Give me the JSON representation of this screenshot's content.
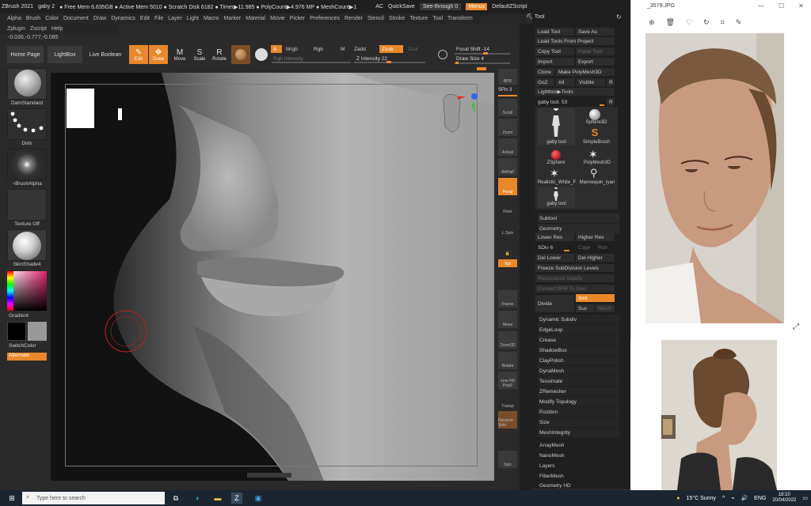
{
  "zbrush": {
    "title_items": [
      "ZBrush 2021",
      "gaby 2",
      "● Free Mem 6.635GB ● Active Mem 5010 ● Scratch Disk 6182 ● Timer▶11.985 ● PolyCount▶4.976 MP ● MeshCount▶1",
      "AC",
      "QuickSave"
    ],
    "see_through": "See-through   0",
    "menus_btn": "Menus",
    "zscript_label": "DefaultZScript",
    "menu_items": [
      "Alpha",
      "Brush",
      "Color",
      "Document",
      "Draw",
      "Dynamics",
      "Edit",
      "File",
      "Layer",
      "Light",
      "Macro",
      "Marker",
      "Material",
      "Movie",
      "Picker",
      "Preferences",
      "Render",
      "Stencil",
      "Stroke",
      "Texture",
      "Tool",
      "Transform"
    ],
    "menu_items2": [
      "Zplugin",
      "Zscript",
      "Help"
    ],
    "coords": "-0.036,-0.777,-0.085",
    "shelf": {
      "home_page": "Home Page",
      "lightbox": "LightBox",
      "live_boolean": "Live Boolean",
      "edit": "Edit",
      "draw": "Draw",
      "move": "Move",
      "scale": "Scale",
      "rotate": "Rotate",
      "a": "A",
      "mrgb": "Mrgb",
      "rgb": "Rgb",
      "m": "M",
      "zadd": "Zadd",
      "zsub": "Zsub",
      "zcut": "Zcut",
      "rgb_intensity": "Rgb Intensity",
      "z_intensity": "Z Intensity 22",
      "focal_shift": "Focal Shift -14",
      "draw_size": "Draw Size 4"
    },
    "left_panel": {
      "brush": "DamStandard",
      "stroke": "Dots",
      "alpha": "~BrushAlpha",
      "texture": "Texture Off",
      "material": "SkinShade4",
      "gradient": "Gradient",
      "switch_color": "SwitchColor",
      "alternate": "Alternate"
    },
    "right_toolbar": [
      "BPR",
      "SPix 3",
      "Scroll",
      "Zoom",
      "Actual",
      "AAHalf",
      "Persp",
      "Floor",
      "L.Sym",
      "Xyz",
      "Frame",
      "Move",
      "Zoom3D",
      "Rotate",
      "Line Fill PolyF",
      "Transp",
      "Dynamic Solo",
      "Spix"
    ],
    "tool_panel": {
      "header": "Tool",
      "load_tool": "Load Tool",
      "save_as": "Save As",
      "load_tools_from_project": "Load Tools From Project",
      "copy_tool": "Copy Tool",
      "paste_tool": "Paste Tool",
      "import": "Import",
      "export": "Export",
      "clone": "Clone",
      "make_polymesh": "Make PolyMesh3D",
      "goz": "GoZ",
      "all": "All",
      "visible": "Visible",
      "r": "R",
      "lightbox_tools": "Lightbox▶Tools",
      "gaby_tool_slider": "gaby tool. 53",
      "tools": [
        "gaby tool",
        "Sphere3D",
        "SimpleBrush",
        "ZSphere",
        "PolyMesh3D",
        "Realistic_White_F",
        "Mannequin_ryan",
        "gaby tool"
      ],
      "subtool": "Subtool",
      "geometry": "Geometry",
      "lower_res": "Lower Res",
      "higher_res": "Higher Res",
      "sdiv": "SDiv 6",
      "cage": "Cage",
      "rstr": "Rstr",
      "del_lower": "Del Lower",
      "del_higher": "Del Higher",
      "freeze_subdiv": "Freeze SubDivision Levels",
      "reconstruct_subdiv": "Reconstruct Subdiv",
      "convert_bpr": "Convert BPR To Geo",
      "divide": "Divide",
      "smt": "Smt",
      "suv": "Suv",
      "reuv": "ReUV",
      "geometry_items": [
        "Dynamic Subdiv",
        "EdgeLoop",
        "Crease",
        "ShadowBox",
        "ClayPolish",
        "DynaMesh",
        "Tessimate",
        "ZRemesher",
        "Modify Topology",
        "Position",
        "Size",
        "MeshIntegrity"
      ],
      "bottom_items": [
        "ArrayMesh",
        "NanoMesh",
        "Layers",
        "FiberMesh",
        "Geometry HD"
      ]
    }
  },
  "photos": {
    "title": "_3579.JPG",
    "toolbar_icons": [
      "zoom-in-icon",
      "delete-icon",
      "heart-icon",
      "rotate-icon",
      "crop-icon",
      "edit-icon"
    ]
  },
  "taskbar": {
    "search_placeholder": "Type here to search",
    "weather": "15°C  Sunny",
    "lang": "ENG",
    "time": "18:10",
    "date": "20/04/2022"
  }
}
